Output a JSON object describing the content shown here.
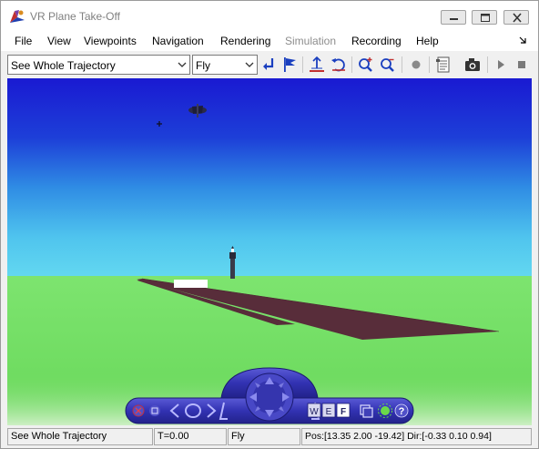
{
  "window": {
    "title": "VR Plane Take-Off"
  },
  "menu": {
    "items": [
      "File",
      "View",
      "Viewpoints",
      "Navigation",
      "Rendering",
      "Simulation",
      "Recording",
      "Help"
    ],
    "disabled": [
      "Simulation"
    ]
  },
  "toolbar": {
    "viewpoint_select": "See Whole Trajectory",
    "navigation_mode_select": "Fly",
    "icons": [
      "return-to-viewpoint-icon",
      "create-viewpoint-icon",
      "straighten-up-icon",
      "undo-move-icon",
      "zoom-in-icon",
      "zoom-out-icon",
      "record-icon",
      "capture-settings-icon",
      "snapshot-icon",
      "play-icon",
      "stop-icon"
    ]
  },
  "nav_panel": {
    "icons": [
      "close-panel-icon",
      "minimize-panel-icon",
      "previous-viewpoint-icon",
      "home-viewpoint-icon",
      "next-viewpoint-icon",
      "navigation-wheel-icon",
      "walk-mode-icon",
      "examine-mode-icon",
      "fly-mode-icon",
      "camera-icon",
      "headlight-icon",
      "help-icon"
    ],
    "mode_letters": [
      "W",
      "E",
      "F"
    ],
    "active_mode": "F"
  },
  "statusbar": {
    "viewpoint": "See Whole Trajectory",
    "time": "T=0.00",
    "mode": "Fly",
    "position": "Pos:[13.35 2.00 -19.42] Dir:[-0.33 0.10 0.94]"
  },
  "colors": {
    "sky_top": "#1a1ad2",
    "sky_horizon": "#5ed3ef",
    "ground": "#79e06a",
    "runway": "#582d3a",
    "nav_panel": "#3a3ab8"
  }
}
